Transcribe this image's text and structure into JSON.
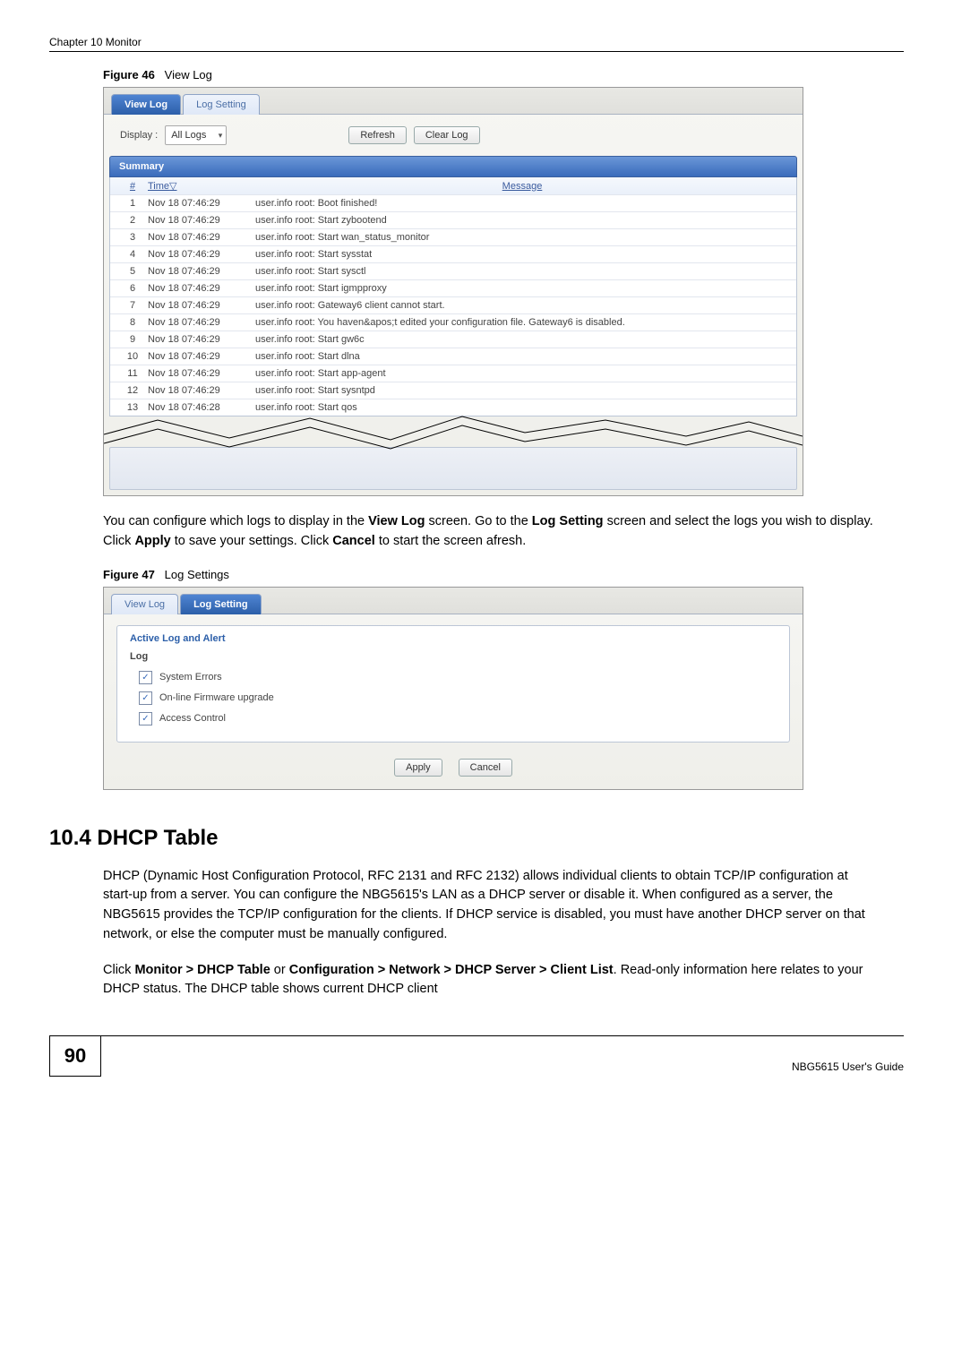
{
  "header": {
    "chapter": "Chapter 10 Monitor"
  },
  "fig46": {
    "label_prefix": "Figure 46",
    "label_text": "View Log",
    "tabs": {
      "view": "View Log",
      "setting": "Log Setting"
    },
    "display_label": "Display :",
    "display_value": "All Logs",
    "refresh": "Refresh",
    "clear": "Clear Log",
    "summary": "Summary",
    "col_num": "#",
    "col_time": "Time",
    "col_msg": "Message",
    "rows": [
      {
        "n": "1",
        "t": "Nov 18 07:46:29",
        "m": "user.info root: Boot finished!"
      },
      {
        "n": "2",
        "t": "Nov 18 07:46:29",
        "m": "user.info root: Start zybootend"
      },
      {
        "n": "3",
        "t": "Nov 18 07:46:29",
        "m": "user.info root: Start wan_status_monitor"
      },
      {
        "n": "4",
        "t": "Nov 18 07:46:29",
        "m": "user.info root: Start sysstat"
      },
      {
        "n": "5",
        "t": "Nov 18 07:46:29",
        "m": "user.info root: Start sysctl"
      },
      {
        "n": "6",
        "t": "Nov 18 07:46:29",
        "m": "user.info root: Start igmpproxy"
      },
      {
        "n": "7",
        "t": "Nov 18 07:46:29",
        "m": "user.info root: Gateway6 client cannot start."
      },
      {
        "n": "8",
        "t": "Nov 18 07:46:29",
        "m": "user.info root: You haven&apos;t edited your configuration file. Gateway6 is disabled."
      },
      {
        "n": "9",
        "t": "Nov 18 07:46:29",
        "m": "user.info root: Start gw6c"
      },
      {
        "n": "10",
        "t": "Nov 18 07:46:29",
        "m": "user.info root: Start dlna"
      },
      {
        "n": "11",
        "t": "Nov 18 07:46:29",
        "m": "user.info root: Start app-agent"
      },
      {
        "n": "12",
        "t": "Nov 18 07:46:29",
        "m": "user.info root: Start sysntpd"
      },
      {
        "n": "13",
        "t": "Nov 18 07:46:28",
        "m": "user.info root: Start qos"
      }
    ]
  },
  "para1": {
    "t1": "You can configure which logs to display in the ",
    "b1": "View Log",
    "t2": " screen. Go to the ",
    "b2": "Log Setting",
    "t3": " screen and select the logs you wish to display. Click ",
    "b3": "Apply",
    "t4": " to save your settings. Click ",
    "b4": "Cancel",
    "t5": " to start the screen afresh."
  },
  "fig47": {
    "label_prefix": "Figure 47",
    "label_text": "Log Settings",
    "tabs": {
      "view": "View Log",
      "setting": "Log Setting"
    },
    "box_title": "Active Log and Alert",
    "box_sub": "Log",
    "opts": {
      "sys": "System Errors",
      "fw": "On-line Firmware upgrade",
      "ac": "Access Control"
    },
    "apply": "Apply",
    "cancel": "Cancel"
  },
  "section": {
    "heading": "10.4  DHCP Table"
  },
  "para2": "DHCP (Dynamic Host Configuration Protocol, RFC 2131 and RFC 2132) allows individual clients to obtain TCP/IP configuration at start-up from a server. You can configure the NBG5615's LAN as a DHCP server or disable it. When configured as a server, the NBG5615 provides the TCP/IP configuration for the clients. If DHCP service is disabled, you must have another DHCP server on that network, or else the computer must be manually configured.",
  "para3": {
    "t1": "Click ",
    "b1": "Monitor > DHCP Table",
    "t2": " or ",
    "b2": "Configuration > Network > DHCP Server > Client List",
    "t3": ". Read-only information here relates to your DHCP status. The DHCP table shows current DHCP client"
  },
  "footer": {
    "page": "90",
    "guide": "NBG5615 User's Guide"
  }
}
